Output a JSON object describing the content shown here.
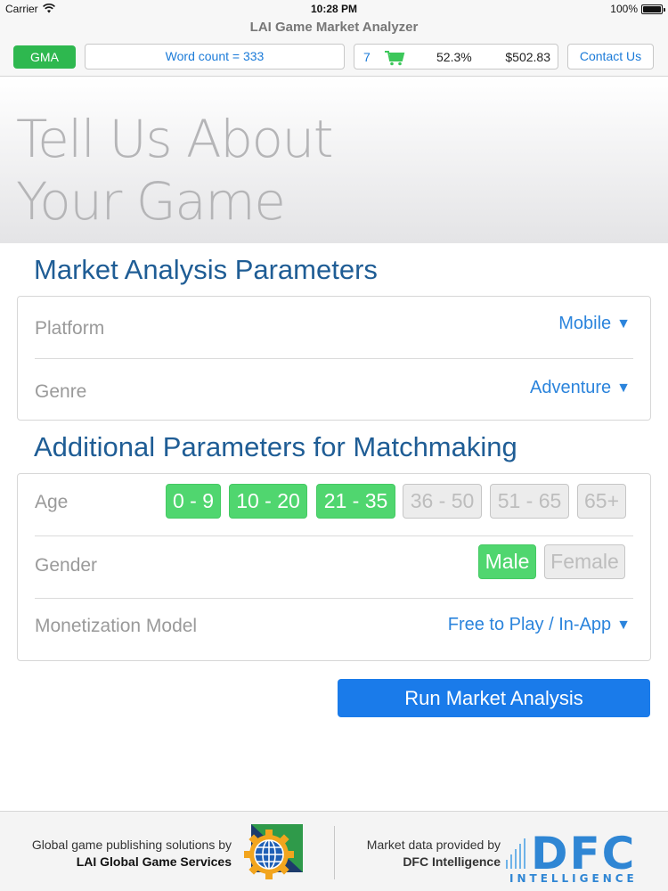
{
  "status_bar": {
    "carrier": "Carrier",
    "time": "10:28 PM",
    "battery": "100%"
  },
  "nav": {
    "title": "LAI Game Market Analyzer",
    "gma_label": "GMA",
    "word_count": "Word count = 333",
    "cart": {
      "count": "7",
      "percent": "52.3%",
      "price": "$502.83"
    },
    "contact_label": "Contact Us"
  },
  "hero": {
    "title": "Tell Us About\nYour Game"
  },
  "market": {
    "title": "Market Analysis Parameters",
    "platform": {
      "label": "Platform",
      "value": "Mobile"
    },
    "genre": {
      "label": "Genre",
      "value": "Adventure"
    }
  },
  "matchmaking": {
    "title": "Additional Parameters for Matchmaking",
    "age": {
      "label": "Age",
      "options": [
        {
          "label": "0 - 9",
          "selected": true
        },
        {
          "label": "10 - 20",
          "selected": true
        },
        {
          "label": "21 - 35",
          "selected": true
        },
        {
          "label": "36 - 50",
          "selected": false
        },
        {
          "label": "51 - 65",
          "selected": false
        },
        {
          "label": "65+",
          "selected": false
        }
      ]
    },
    "gender": {
      "label": "Gender",
      "options": [
        {
          "label": "Male",
          "selected": true
        },
        {
          "label": "Female",
          "selected": false
        }
      ]
    },
    "monetization": {
      "label": "Monetization Model",
      "value": "Free to Play / In-App"
    }
  },
  "run_label": "Run Market Analysis",
  "footer": {
    "left_line1": "Global game publishing solutions by",
    "left_line2": "LAI Global Game Services",
    "right_line1": "Market data provided by",
    "right_line2": "DFC Intelligence",
    "dfc_logo_text": "DFC",
    "dfc_logo_sub": "INTELLIGENCE"
  },
  "colors": {
    "accent_blue": "#1a7bea",
    "selected_green": "#50d66f",
    "gma_green": "#2eb84f",
    "section_title": "#1f5d95"
  },
  "icons": [
    "wifi-icon",
    "battery-icon",
    "cart-icon",
    "dropdown-triangle-icon",
    "globe-gear-logo",
    "dfc-logo"
  ]
}
